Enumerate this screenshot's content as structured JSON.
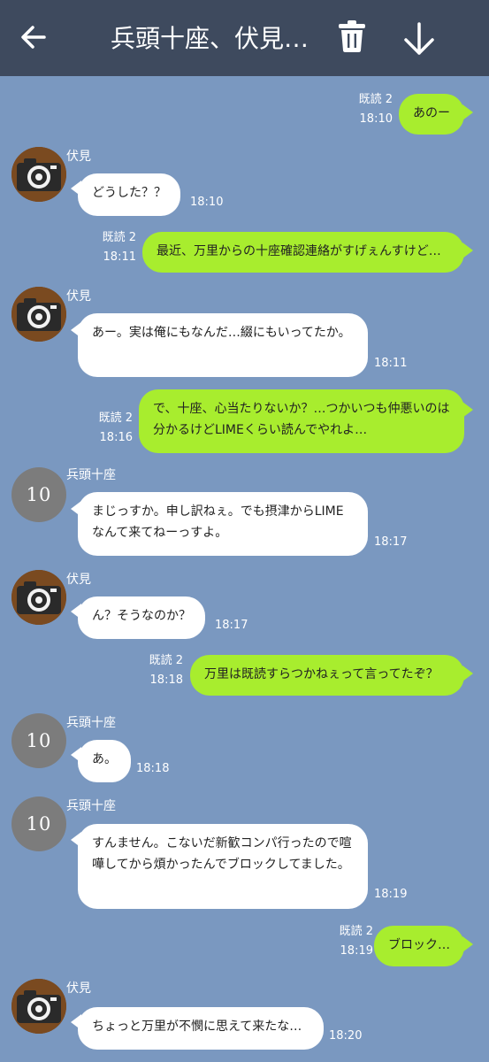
{
  "header": {
    "title": "兵頭十座、伏見…",
    "back_icon": "arrow-left-icon",
    "trash_icon": "trash-icon",
    "download_icon": "arrow-down-icon"
  },
  "avatars": {
    "taichi_badge": "10"
  },
  "messages": [
    {
      "side": "out",
      "read": "既読 2",
      "time": "18:10",
      "text": "あのー"
    },
    {
      "side": "in",
      "sender": "伏見",
      "avatar": "camera",
      "time": "18:10",
      "text": "どうした？？"
    },
    {
      "side": "out",
      "read": "既読 2",
      "time": "18:11",
      "text": "最近、万里からの十座確認連絡がすげぇんすけど…"
    },
    {
      "side": "in",
      "sender": "伏見",
      "avatar": "camera",
      "time": "18:11",
      "text": "あー。実は俺にもなんだ…綴にもいってたか。"
    },
    {
      "side": "out",
      "read": "既読 2",
      "time": "18:16",
      "text": "で、十座、心当たりないか？…つかいつも仲悪いのは分かるけどLIMEくらい読んでやれよ…"
    },
    {
      "side": "in",
      "sender": "兵頭十座",
      "avatar": "10",
      "time": "18:17",
      "text": "まじっすか。申し訳ねぇ。でも摂津からLIMEなんて来てねーっすよ。"
    },
    {
      "side": "in",
      "sender": "伏見",
      "avatar": "camera",
      "time": "18:17",
      "text": "ん？そうなのか？"
    },
    {
      "side": "out",
      "read": "既読 2",
      "time": "18:18",
      "text": "万里は既読すらつかねぇって言ってたぞ？"
    },
    {
      "side": "in",
      "sender": "兵頭十座",
      "avatar": "10",
      "time": "18:18",
      "text": "あ。"
    },
    {
      "side": "in",
      "sender": "兵頭十座",
      "avatar": "10",
      "time": "18:19",
      "text": "すんません。こないだ新歓コンパ行ったので喧嘩してから煩かったんでブロックしてました。"
    },
    {
      "side": "out",
      "read": "既読 2",
      "time": "18:19",
      "text": "ブロック…"
    },
    {
      "side": "in",
      "sender": "伏見",
      "avatar": "camera",
      "time": "18:20",
      "text": "ちょっと万里が不憫に思えて来たな…"
    }
  ]
}
